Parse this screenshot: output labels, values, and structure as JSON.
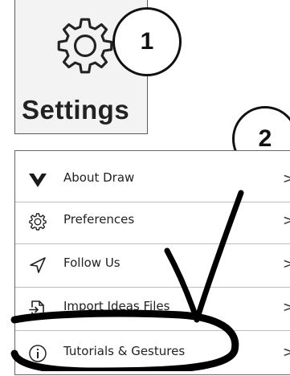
{
  "settings_tile": {
    "label": "Settings",
    "icon": "gear-icon"
  },
  "callouts": {
    "first": "1",
    "second": "2"
  },
  "menu": {
    "items": [
      {
        "label": "About Draw",
        "icon": "draw-logo-icon",
        "chevron": ">"
      },
      {
        "label": "Preferences",
        "icon": "gear-icon",
        "chevron": ">"
      },
      {
        "label": "Follow Us",
        "icon": "send-arrow-icon",
        "chevron": ">"
      },
      {
        "label": "Import Ideas Files",
        "icon": "import-icon",
        "chevron": ">"
      },
      {
        "label": "Tutorials & Gestures",
        "icon": "info-icon",
        "chevron": ">"
      }
    ]
  },
  "annotations": {
    "checkmark": "checkmark-annotation",
    "highlight": "circle-highlight-annotation"
  }
}
